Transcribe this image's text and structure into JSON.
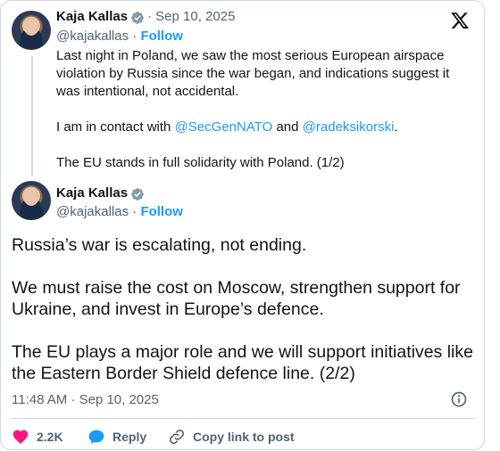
{
  "tweet1": {
    "name": "Kaja Kallas",
    "date": "· Sep 10, 2025",
    "handle": "@kajakallas",
    "sep": "·",
    "follow": "Follow",
    "para1": "Last night in Poland, we saw the most serious European airspace violation by Russia since the war began, and indications suggest it was intentional, not accidental.",
    "para2_prefix": "I am in contact with ",
    "mention1": "@SecGenNATO",
    "para2_mid": " and ",
    "mention2": "@radeksikorski",
    "para2_suffix": ".",
    "para3": "The EU stands in full solidarity with Poland. (1/2)"
  },
  "tweet2": {
    "name": "Kaja Kallas",
    "handle": "@kajakallas",
    "sep": "·",
    "follow": "Follow",
    "para1": "Russia’s war is escalating, not ending.",
    "para2": "We must raise the cost on Moscow, strengthen support for Ukraine, and invest in Europe’s defence.",
    "para3": "The EU plays a major role and we will support initiatives like the Eastern Border Shield defence line. (2/2)",
    "timestamp": "11:48 AM · Sep 10, 2025"
  },
  "actions": {
    "likes": "2.2K",
    "reply": "Reply",
    "copy": "Copy link to post"
  },
  "colors": {
    "accent": "#1d9bf0",
    "like": "#f91880",
    "text_secondary": "#536471",
    "border": "#cfd9de"
  },
  "icons": [
    "verified-badge-icon",
    "x-logo-icon",
    "info-icon",
    "heart-icon",
    "reply-icon",
    "link-icon"
  ]
}
